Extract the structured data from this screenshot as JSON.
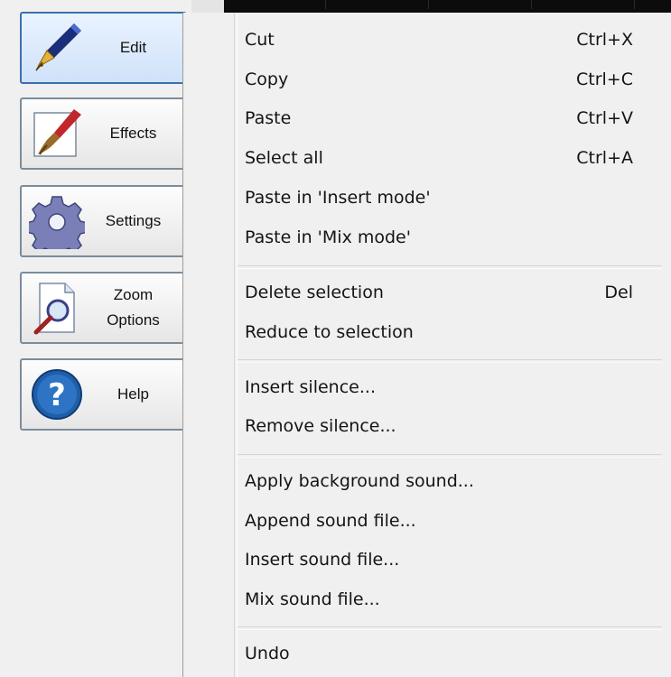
{
  "toolbar": {
    "buttons": [
      {
        "label": "Edit",
        "icon": "fountain-pen-icon",
        "active": true
      },
      {
        "label": "Effects",
        "icon": "paintbrush-icon",
        "active": false
      },
      {
        "label": "Settings",
        "icon": "gear-icon",
        "active": false
      },
      {
        "label": "Zoom Options",
        "label_line1": "Zoom",
        "label_line2": "Options",
        "icon": "magnifier-document-icon",
        "active": false
      },
      {
        "label": "Help",
        "icon": "question-mark-icon",
        "active": false
      }
    ]
  },
  "menu": {
    "items": [
      {
        "label": "Cut",
        "shortcut": "Ctrl+X"
      },
      {
        "label": "Copy",
        "shortcut": "Ctrl+C"
      },
      {
        "label": "Paste",
        "shortcut": "Ctrl+V"
      },
      {
        "label": "Select all",
        "shortcut": "Ctrl+A"
      },
      {
        "label": "Paste in 'Insert mode'",
        "shortcut": ""
      },
      {
        "label": "Paste in 'Mix mode'",
        "shortcut": ""
      },
      {
        "label": "Delete selection",
        "shortcut": "Del"
      },
      {
        "label": "Reduce to selection",
        "shortcut": ""
      },
      {
        "label": "Insert silence...",
        "shortcut": ""
      },
      {
        "label": "Remove silence...",
        "shortcut": ""
      },
      {
        "label": "Apply background sound...",
        "shortcut": ""
      },
      {
        "label": "Append sound file...",
        "shortcut": ""
      },
      {
        "label": "Insert sound file...",
        "shortcut": ""
      },
      {
        "label": "Mix sound file...",
        "shortcut": ""
      },
      {
        "label": "Undo",
        "shortcut": ""
      }
    ]
  },
  "colors": {
    "active_button_border": "#3c6fb0",
    "menu_background": "#f0f0f0",
    "waveform_background": "#0c0c0c"
  }
}
